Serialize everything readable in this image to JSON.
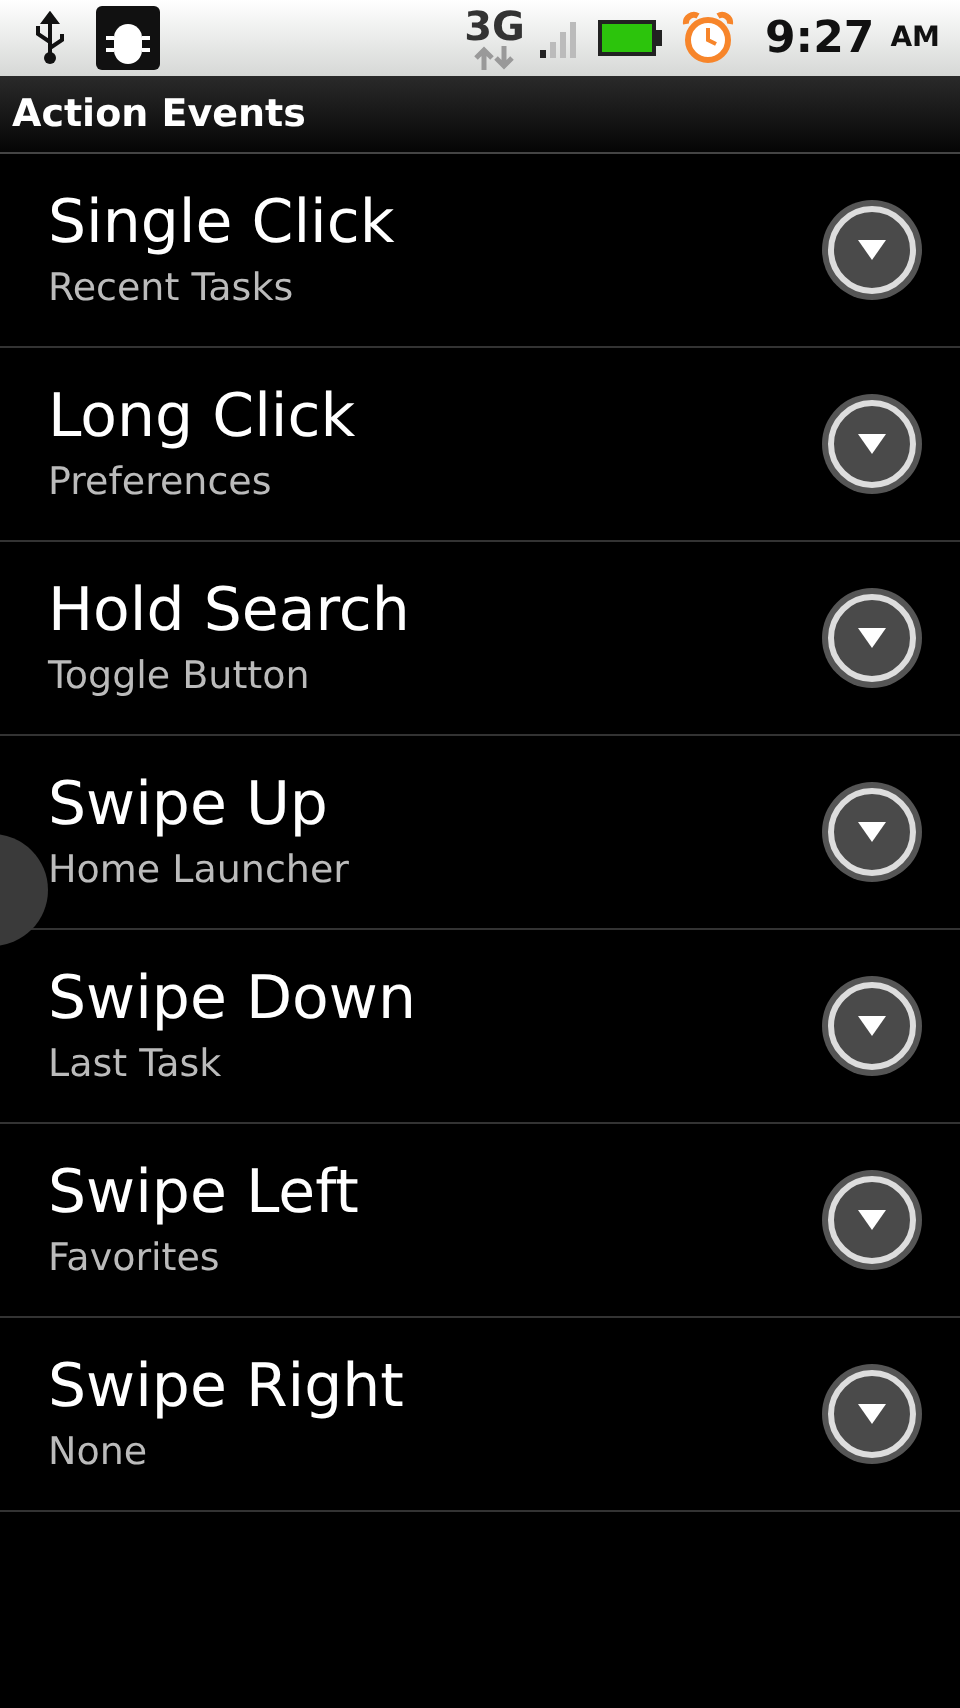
{
  "status_bar": {
    "network": "3G",
    "time": "9:27",
    "meridiem": "AM"
  },
  "title_bar": {
    "title": "Action Events"
  },
  "events": [
    {
      "title": "Single Click",
      "value": "Recent Tasks"
    },
    {
      "title": "Long Click",
      "value": "Preferences"
    },
    {
      "title": "Hold Search",
      "value": "Toggle Button"
    },
    {
      "title": "Swipe Up",
      "value": "Home Launcher"
    },
    {
      "title": "Swipe Down",
      "value": "Last Task"
    },
    {
      "title": "Swipe Left",
      "value": "Favorites"
    },
    {
      "title": "Swipe Right",
      "value": "None"
    }
  ]
}
